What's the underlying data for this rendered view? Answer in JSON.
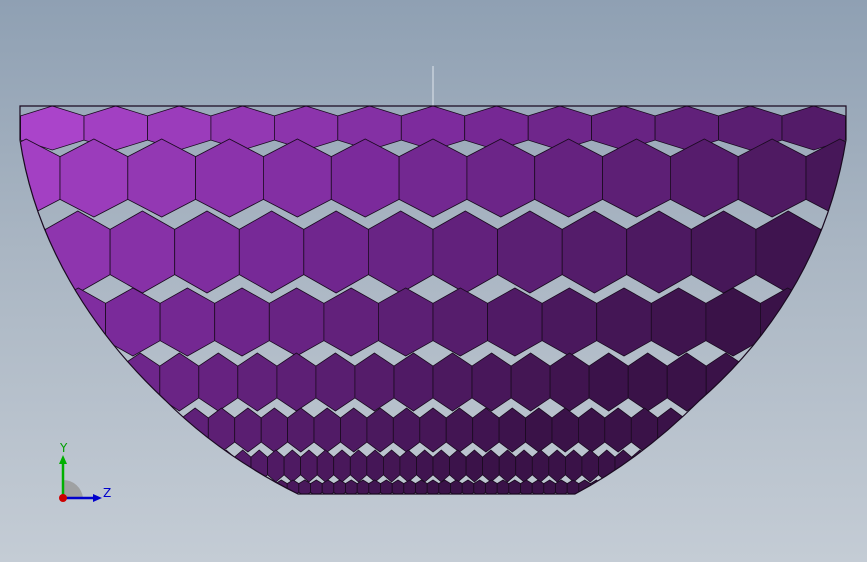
{
  "viewport": {
    "background_top": "#8fa0b3",
    "background_bottom": "#c4ccd5"
  },
  "model": {
    "name": "faceted-hemispherical-bowl",
    "base_color": "#7a2a9a",
    "highlight_color": "#b040d0",
    "shadow_color": "#3a1248",
    "edge_color": "#1a0a20"
  },
  "triad": {
    "y_label": "Y",
    "z_label": "Z",
    "y_color": "#00b000",
    "z_color": "#0000cc",
    "x_color": "#cc0000"
  }
}
